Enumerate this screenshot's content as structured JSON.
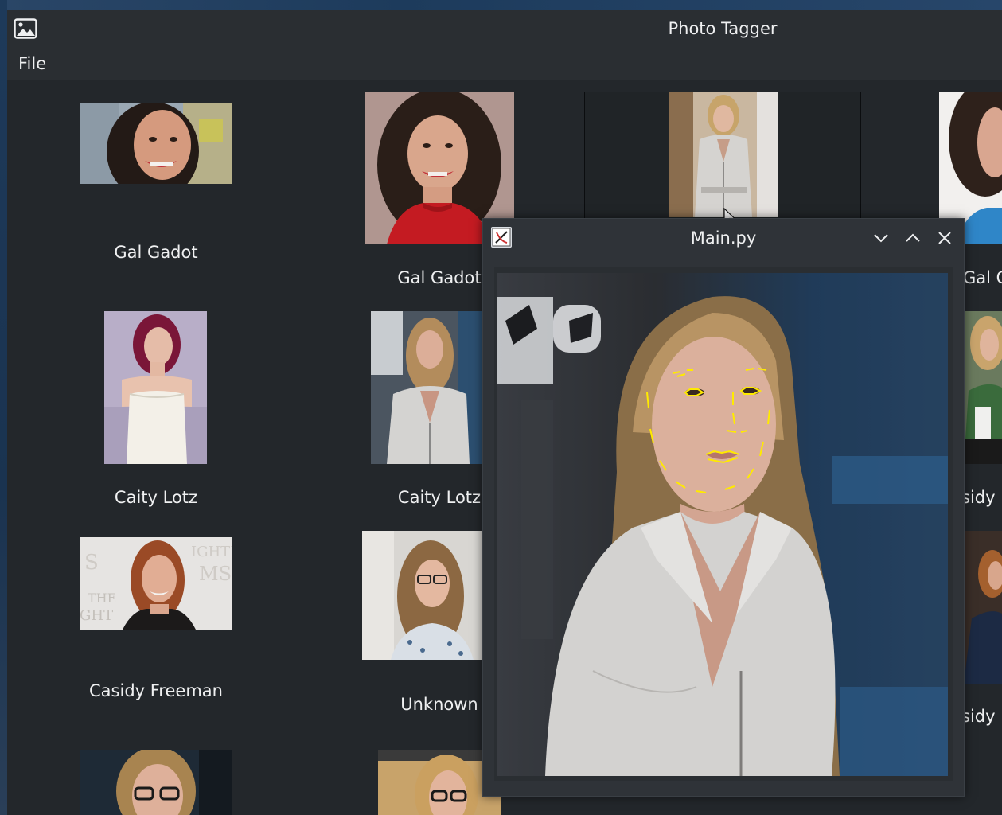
{
  "app": {
    "title": "Photo Tagger"
  },
  "menu": {
    "file": "File"
  },
  "photos": [
    {
      "caption": "Gal Gadot"
    },
    {
      "caption": "Gal Gadot"
    },
    {
      "caption": ""
    },
    {
      "caption": "Gal G"
    },
    {
      "caption": "Caity Lotz"
    },
    {
      "caption": "Caity Lotz"
    },
    {
      "caption": "sidy"
    },
    {
      "caption": "Casidy Freeman"
    },
    {
      "caption": "Unknown"
    },
    {
      "caption": "sidy"
    }
  ],
  "dialog": {
    "title": "Main.py"
  },
  "icons": {
    "app": "image-icon",
    "dialog": "python-icon",
    "minimize": "chevron-down-icon",
    "maximize": "chevron-up-icon",
    "close": "close-icon"
  },
  "colors": {
    "window_bg": "#2a2e32",
    "grid_bg": "#23272b",
    "text": "#eff0f1",
    "landmarks": "#ffea00"
  }
}
